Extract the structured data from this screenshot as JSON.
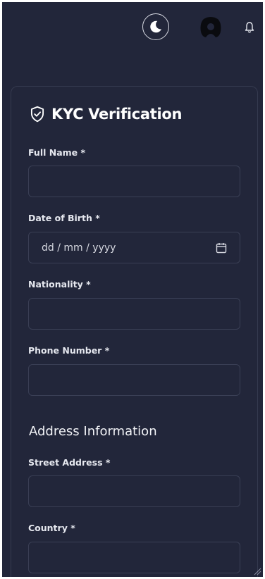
{
  "header": {
    "theme_toggle_icon": "moon-icon",
    "avatar_icon": "user-avatar",
    "notification_icon": "bell-icon"
  },
  "kyc": {
    "title": "KYC Verification",
    "title_icon": "shield-check-icon",
    "fields": {
      "full_name": {
        "label": "Full Name *",
        "value": ""
      },
      "date_of_birth": {
        "label": "Date of Birth *",
        "placeholder": "dd / mm / yyyy",
        "icon": "calendar-icon"
      },
      "nationality": {
        "label": "Nationality *",
        "value": ""
      },
      "phone_number": {
        "label": "Phone Number *",
        "value": ""
      }
    },
    "address_section": {
      "heading": "Address Information",
      "fields": {
        "street_address": {
          "label": "Street Address *",
          "value": ""
        },
        "country": {
          "label": "Country *",
          "value": ""
        }
      }
    }
  },
  "colors": {
    "background": "#22263a",
    "input_border": "#3a3f55",
    "text": "#ffffff"
  }
}
